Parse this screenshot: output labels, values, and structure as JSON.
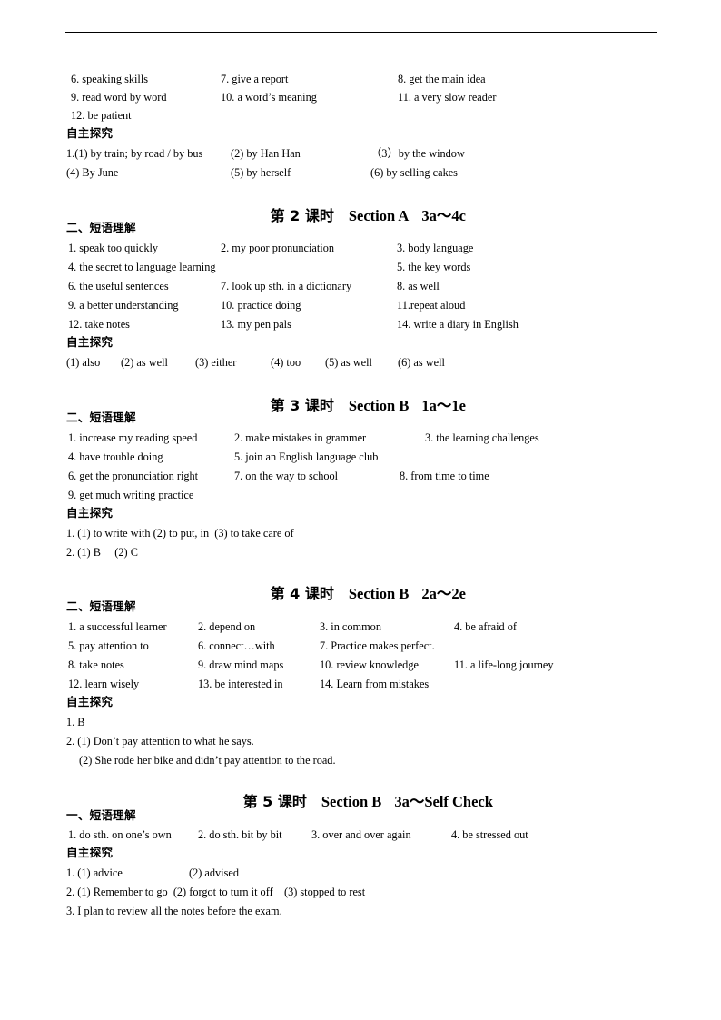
{
  "document": {
    "type": "answer-key-worksheet",
    "language": "zh-CN + en"
  },
  "block1": {
    "items": [
      "6. speaking skills",
      "7. give a report",
      "8. get the main idea",
      "9. read word by word",
      "10. a word’s meaning",
      "11. a very slow reader",
      "12. be patient"
    ],
    "explore_heading": "自主探究",
    "explore_lines": [
      "1.(1) by train; by road / by bus",
      "(2) by Han Han",
      "（3）by the window",
      "(4) By June",
      "(5) by herself",
      "(6) by selling cakes"
    ]
  },
  "lesson2": {
    "cjk": "第 2 课时",
    "section": "Section A",
    "range": "3a～4c",
    "phrase_heading": "二、短语理解",
    "phrases": [
      "1. speak too quickly",
      "2. my poor pronunciation",
      "3. body language",
      "4. the secret to language learning",
      "5. the key words",
      "6. the useful sentences",
      "7. look up sth. in a dictionary",
      "8. as well",
      "9. a better understanding",
      "10. practice doing",
      "11.repeat aloud",
      "12. take notes",
      "13. my pen pals",
      "14. write a diary in English"
    ],
    "explore_heading": "自主探究",
    "explore_answers": [
      "(1) also",
      "(2) as well",
      "(3) either",
      "(4) too",
      "(5) as well",
      "(6) as well"
    ]
  },
  "lesson3": {
    "cjk": "第 3 课时",
    "section": "Section B",
    "range": "1a～1e",
    "phrase_heading": "二、短语理解",
    "phrases": [
      "1. increase my reading speed",
      "2. make mistakes in grammer",
      "3. the learning challenges",
      "4. have trouble doing",
      "5. join an English language club",
      "6. get the pronunciation right",
      "7. on the way to school",
      "8. from time to time",
      "9. get much writing practice"
    ],
    "explore_heading": "自主探究",
    "explore_lines": [
      "1. (1) to write with (2) to put, in  (3) to take care of",
      "2. (1) B     (2) C"
    ]
  },
  "lesson4": {
    "cjk": "第 4 课时",
    "section": "Section B",
    "range": "2a～2e",
    "phrase_heading": "二、短语理解",
    "phrases": [
      "1. a successful learner",
      "2. depend on",
      "3. in common",
      "4. be afraid of",
      "5. pay attention to",
      "6. connect…with",
      "7. Practice makes perfect.",
      "8. take notes",
      "9. draw mind maps",
      "10. review knowledge",
      "11. a life-long journey",
      "12. learn wisely",
      "13. be interested in",
      "14. Learn from mistakes"
    ],
    "explore_heading": "自主探究",
    "explore_lines": [
      "1. B",
      "2. (1) Don’t pay attention to what he says.",
      "(2) She rode her bike and didn’t pay attention to the road."
    ]
  },
  "lesson5": {
    "cjk": "第 5 课时",
    "section": "Section B",
    "range": "3a～Self Check",
    "phrase_heading": "一、短语理解",
    "phrases": [
      "1. do sth. on one’s own",
      "2. do sth. bit by bit",
      "3. over and over again",
      "4. be stressed out"
    ],
    "explore_heading": "自主探究",
    "explore_lines": [
      "1. (1) advice",
      "(2) advised",
      "2. (1) Remember to go  (2) forgot to turn it off    (3) stopped to rest",
      "3. I plan to review all the notes before the exam."
    ]
  }
}
